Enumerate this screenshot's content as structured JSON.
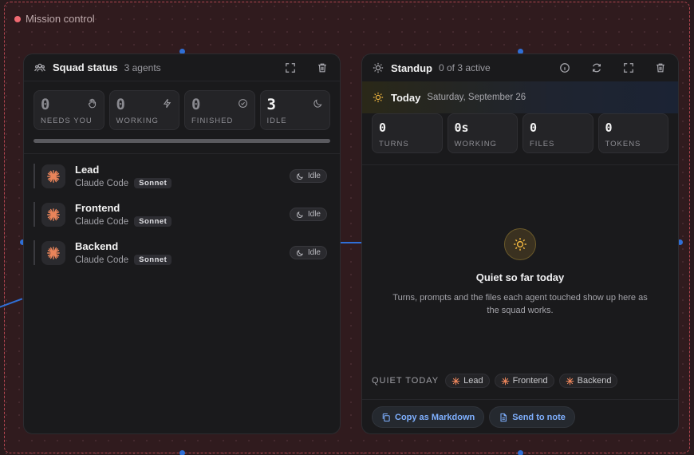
{
  "group": {
    "label": "Mission control"
  },
  "squad": {
    "title": "Squad status",
    "subtitle": "3 agents",
    "stats": [
      {
        "value": "0",
        "label": "NEEDS YOU",
        "icon": "hand-icon"
      },
      {
        "value": "0",
        "label": "WORKING",
        "icon": "bolt-icon"
      },
      {
        "value": "0",
        "label": "FINISHED",
        "icon": "check-circle-icon"
      },
      {
        "value": "3",
        "label": "IDLE",
        "icon": "moon-icon"
      }
    ],
    "agents": [
      {
        "name": "Lead",
        "tool": "Claude Code",
        "model": "Sonnet",
        "status": "Idle"
      },
      {
        "name": "Frontend",
        "tool": "Claude Code",
        "model": "Sonnet",
        "status": "Idle"
      },
      {
        "name": "Backend",
        "tool": "Claude Code",
        "model": "Sonnet",
        "status": "Idle"
      }
    ]
  },
  "standup": {
    "title": "Standup",
    "subtitle": "0 of 3 active",
    "today_title": "Today",
    "today_date": "Saturday, September 26",
    "stats": [
      {
        "value": "0",
        "label": "TURNS"
      },
      {
        "value": "0s",
        "label": "WORKING"
      },
      {
        "value": "0",
        "label": "FILES"
      },
      {
        "value": "0",
        "label": "TOKENS"
      }
    ],
    "empty_title": "Quiet so far today",
    "empty_desc": "Turns, prompts and the files each agent touched show up here as the squad works.",
    "quiet_label": "QUIET TODAY",
    "quiet_agents": [
      "Lead",
      "Frontend",
      "Backend"
    ],
    "copy_button": "Copy as Markdown",
    "note_button": "Send to note"
  },
  "colors": {
    "accent": "#7fb0ff",
    "agent_icon": "#e9845a",
    "sun": "#f0b640",
    "group_border": "#b0454f"
  }
}
